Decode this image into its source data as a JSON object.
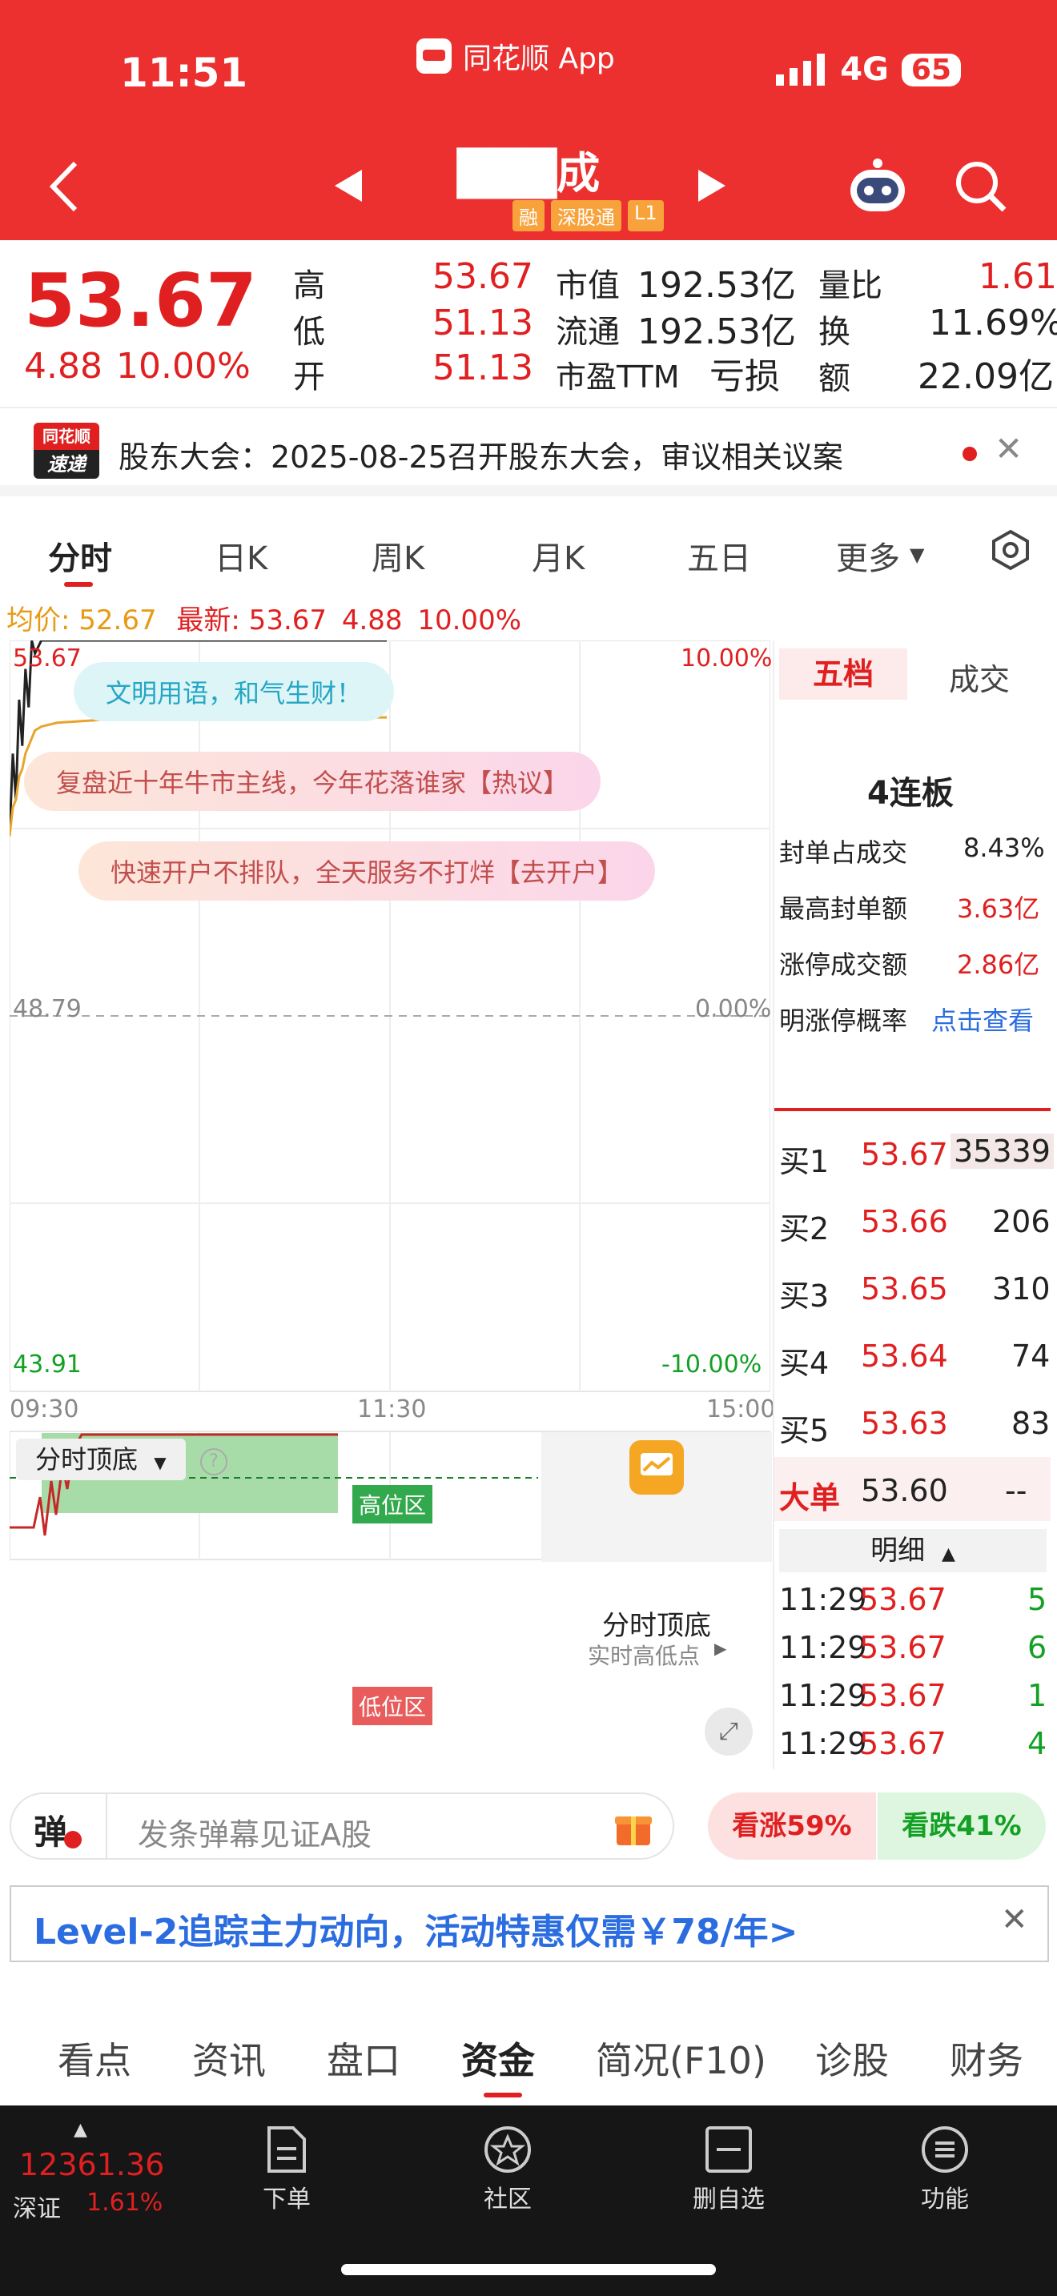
{
  "status_bar": {
    "time": "11:51",
    "app_name": "同花顺 App",
    "network": "4G",
    "battery": "65"
  },
  "nav": {
    "stock_name": "███成",
    "tags": [
      "融",
      "深股通",
      "L1"
    ]
  },
  "quote": {
    "price": "53.67",
    "change": "4.88",
    "change_pct": "10.00%",
    "high_label": "高",
    "high": "53.67",
    "low_label": "低",
    "low": "51.13",
    "open_label": "开",
    "open": "51.13",
    "mktcap_label": "市值",
    "mktcap": "192.53亿",
    "float_label": "流通",
    "float": "192.53亿",
    "pe_label": "市盈TTM",
    "pe": "亏损",
    "vol_ratio_label": "量比",
    "vol_ratio": "1.61",
    "turnover_label": "换",
    "turnover": "11.69%",
    "amount_label": "额",
    "amount": "22.09亿"
  },
  "news": {
    "badge_top": "同花顺",
    "badge_bottom": "速递",
    "text": "股东大会：2025-08-25召开股东大会，审议相关议案"
  },
  "chart_tabs": [
    "分时",
    "日K",
    "周K",
    "月K",
    "五日",
    "更多"
  ],
  "chart_header": {
    "avg_label": "均价: 52.67",
    "latest_label": "最新: 53.67",
    "change": "4.88",
    "change_pct": "10.00%"
  },
  "chart_labels": {
    "y_top": "53.67",
    "y_mid": "48.79",
    "y_bottom": "43.91",
    "pct_top": "10.00%",
    "pct_mid": "0.00%",
    "pct_bottom": "-10.00%",
    "t_start": "09:30",
    "t_mid": "11:30",
    "t_end": "15:00"
  },
  "chart_data": {
    "type": "line",
    "x": [
      "09:30",
      "09:31",
      "09:32",
      "09:33",
      "09:34",
      "09:35",
      "09:36",
      "09:37",
      "09:38",
      "09:40",
      "09:45",
      "10:00",
      "10:30",
      "11:00",
      "11:29"
    ],
    "series": [
      {
        "name": "最新",
        "values": [
          51.13,
          52.2,
          51.6,
          52.9,
          52.3,
          53.3,
          52.8,
          53.67,
          53.5,
          53.67,
          53.67,
          53.67,
          53.67,
          53.67,
          53.67
        ]
      },
      {
        "name": "均价",
        "values": [
          51.13,
          51.5,
          51.6,
          51.9,
          52.0,
          52.2,
          52.3,
          52.4,
          52.5,
          52.55,
          52.6,
          52.64,
          52.66,
          52.67,
          52.67
        ]
      }
    ],
    "ylim": [
      43.91,
      53.67
    ]
  },
  "pills": [
    "文明用语，和气生财！",
    "复盘近十年牛市主线，今年花落谁家【热议】",
    "快速开户不排队，全天服务不打烊【去开户】"
  ],
  "indicator": {
    "name": "分时顶底",
    "high_zone": "高位区",
    "low_zone": "低位区",
    "promo_title": "分时顶底",
    "promo_sub": "实时高低点"
  },
  "panel": {
    "tabs": [
      "五档",
      "成交"
    ],
    "board": "4连板",
    "stats": [
      {
        "label": "封单占成交",
        "value": "8.43%"
      },
      {
        "label": "最高封单额",
        "value": "3.63亿"
      },
      {
        "label": "涨停成交额",
        "value": "2.86亿"
      },
      {
        "label": "明涨停概率",
        "value": "点击查看"
      }
    ],
    "bids": [
      {
        "label": "买1",
        "price": "53.67",
        "vol": "35339"
      },
      {
        "label": "买2",
        "price": "53.66",
        "vol": "206"
      },
      {
        "label": "买3",
        "price": "53.65",
        "vol": "310"
      },
      {
        "label": "买4",
        "price": "53.64",
        "vol": "74"
      },
      {
        "label": "买5",
        "price": "53.63",
        "vol": "83"
      }
    ],
    "big_order": {
      "label": "大单",
      "price": "53.60",
      "vol": "--"
    },
    "detail_label": "明细",
    "ticks": [
      {
        "time": "11:29",
        "price": "53.67",
        "vol": "5"
      },
      {
        "time": "11:29",
        "price": "53.67",
        "vol": "6"
      },
      {
        "time": "11:29",
        "price": "53.67",
        "vol": "1"
      },
      {
        "time": "11:29",
        "price": "53.67",
        "vol": "4"
      }
    ]
  },
  "danmu": {
    "badge": "弹",
    "placeholder": "发条弹幕见证A股",
    "up": "看涨59%",
    "down": "看跌41%"
  },
  "banner": {
    "text": "Level-2追踪主力动向，活动特惠仅需￥78/年>"
  },
  "bottom_tabs": [
    "看点",
    "资讯",
    "盘口",
    "资金",
    "简况(F10)",
    "诊股",
    "财务"
  ],
  "bottom_bar": {
    "index_value": "12361.36",
    "index_name": "深证",
    "index_pct": "1.61%",
    "items": [
      "下单",
      "社区",
      "删自选",
      "功能"
    ]
  }
}
